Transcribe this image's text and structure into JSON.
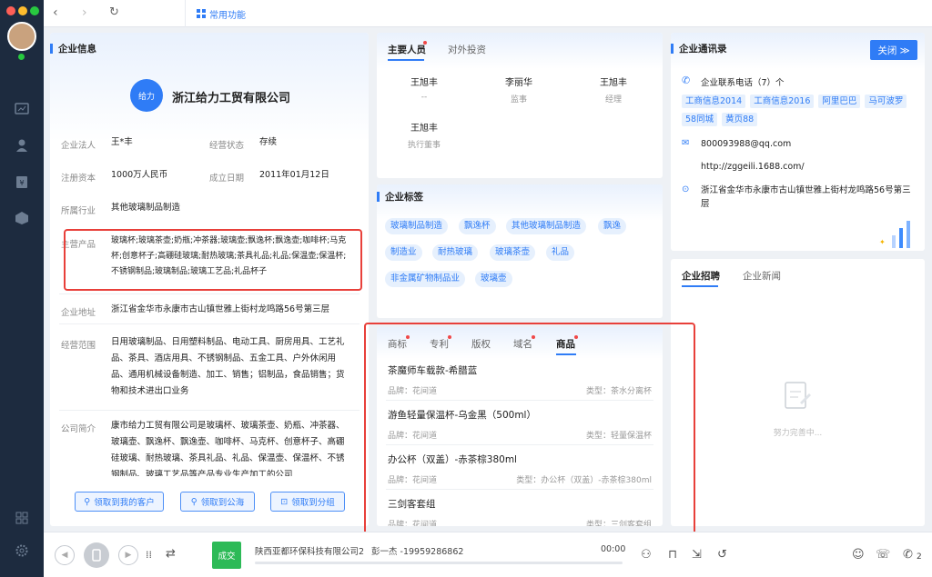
{
  "nav": {
    "common_tab": "常用功能"
  },
  "company": {
    "section_title": "企业信息",
    "logo_text": "给力",
    "name": "浙江给力工贸有限公司",
    "legal_label": "企业法人",
    "legal_value": "王*丰",
    "status_label": "经营状态",
    "status_value": "存续",
    "capital_label": "注册资本",
    "capital_value": "1000万人民币",
    "founded_label": "成立日期",
    "founded_value": "2011年01月12日",
    "industry_label": "所属行业",
    "industry_value": "其他玻璃制品制造",
    "products_label": "主营产品",
    "products_value": "玻璃杯;玻璃茶壶;奶瓶;冲茶器;玻璃壶;飘逸杯;飘逸壶;咖啡杯;马克杯;创意杯子;高硼硅玻璃;耐热玻璃;茶具礼品;礼品;保温壶;保温杯;不锈钢制品;玻璃制品;玻璃工艺品;礼品杯子",
    "address_label": "企业地址",
    "address_value": "浙江省金华市永康市古山镇世雅上街村龙鸣路56号第三层",
    "scope_label": "经营范围",
    "scope_value": "日用玻璃制品、日用塑料制品、电动工具、厨房用具、工艺礼品、茶具、酒店用具、不锈钢制品、五金工具、户外休闲用品、通用机械设备制造、加工、销售；铝制品，食品销售；货物和技术进出口业务",
    "intro_label": "公司简介",
    "intro_value": "康市给力工贸有限公司是玻璃杯、玻璃茶壶、奶瓶、冲茶器、玻璃壶、飘逸杯、飘逸壶、咖啡杯、马克杯、创意杯子、高硼硅玻璃、耐热玻璃、茶具礼品、礼品、保温壶、保温杯、不锈钢制品、玻璃工艺品等产品专业生产加工的公司",
    "btn_my_customers": "领取到我的客户",
    "btn_public_sea": "领取到公海",
    "btn_group": "领取到分组"
  },
  "people": {
    "tab_main": "主要人员",
    "tab_invest": "对外投资",
    "list": [
      {
        "name": "王旭丰",
        "role": "--"
      },
      {
        "name": "李丽华",
        "role": "监事"
      },
      {
        "name": "王旭丰",
        "role": "经理"
      },
      {
        "name": "王旭丰",
        "role": "执行董事"
      }
    ]
  },
  "tags": {
    "title": "企业标签",
    "items": [
      "玻璃制品制造",
      "飘逸杯",
      "其他玻璃制品制造",
      "飘逸",
      "制造业",
      "耐热玻璃",
      "玻璃茶壶",
      "礼品",
      "非金属矿物制品业",
      "玻璃壶"
    ]
  },
  "ip": {
    "tabs": [
      "商标",
      "专利",
      "版权",
      "域名",
      "商品"
    ],
    "products": [
      {
        "title": "茶魔师车载款-希腊蓝",
        "brand": "品牌：花间道",
        "type": "类型：茶水分离杯"
      },
      {
        "title": "游鱼轻量保温杯-乌金黑（500ml）",
        "brand": "品牌：花间道",
        "type": "类型：轻量保温杯"
      },
      {
        "title": "办公杯（双盖）-赤茶棕380ml",
        "brand": "品牌：花间道",
        "type": "类型：办公杯（双盖）-赤茶棕380ml"
      },
      {
        "title": "三剑客套组",
        "brand": "品牌：花间道",
        "type": "类型：三剑客套组"
      }
    ]
  },
  "contacts": {
    "title": "企业通讯录",
    "close_label": "关闭 ≫",
    "phone_label": "企业联系电话（7）个",
    "sources": [
      "工商信息2014",
      "工商信息2016",
      "阿里巴巴",
      "马可波罗",
      "58同城",
      "黄页88"
    ],
    "email": "800093988@qq.com",
    "website": "http://zggeili.1688.com/",
    "address": "浙江省金华市永康市古山镇世雅上街村龙鸣路56号第三层"
  },
  "recruit": {
    "tab_recruit": "企业招聘",
    "tab_news": "企业新闻",
    "empty_text": "努力完善中..."
  },
  "call": {
    "deal_label": "成交",
    "company": "陕西亚都环保科技有限公司2",
    "contact": "彭一杰 -19959286862",
    "timer": "00:00",
    "badge": "2"
  },
  "colors": {
    "accent": "#2f7cf6",
    "sidebar": "#1d2b3f",
    "highlight": "#e8403a",
    "deal": "#2dba57"
  }
}
